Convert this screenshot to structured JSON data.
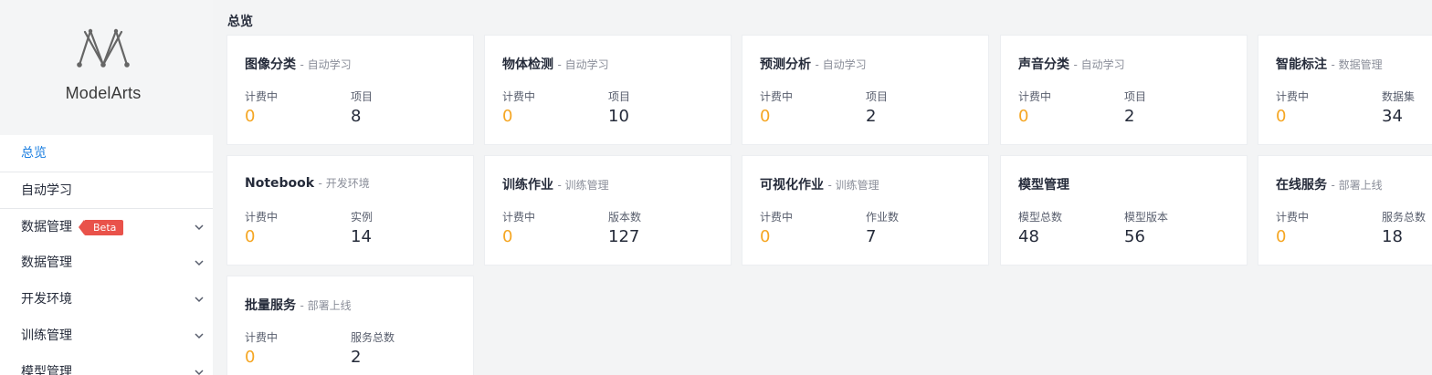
{
  "app": {
    "name": "ModelArts"
  },
  "page": {
    "title": "总览"
  },
  "sidebar": {
    "items": [
      {
        "label": "总览",
        "active": true,
        "expandable": false
      },
      {
        "label": "自动学习",
        "active": false,
        "expandable": false
      },
      {
        "label": "数据管理",
        "active": false,
        "expandable": true,
        "badge": "Beta"
      },
      {
        "label": "数据管理",
        "active": false,
        "expandable": true
      },
      {
        "label": "开发环境",
        "active": false,
        "expandable": true
      },
      {
        "label": "训练管理",
        "active": false,
        "expandable": true
      },
      {
        "label": "模型管理",
        "active": false,
        "expandable": true
      }
    ]
  },
  "cards": [
    {
      "title": "图像分类",
      "subtitle": "- 自动学习",
      "stats": [
        {
          "label": "计费中",
          "value": "0"
        },
        {
          "label": "项目",
          "value": "8"
        }
      ]
    },
    {
      "title": "物体检测",
      "subtitle": "- 自动学习",
      "stats": [
        {
          "label": "计费中",
          "value": "0"
        },
        {
          "label": "项目",
          "value": "10"
        }
      ]
    },
    {
      "title": "预测分析",
      "subtitle": "- 自动学习",
      "stats": [
        {
          "label": "计费中",
          "value": "0"
        },
        {
          "label": "项目",
          "value": "2"
        }
      ]
    },
    {
      "title": "声音分类",
      "subtitle": "- 自动学习",
      "stats": [
        {
          "label": "计费中",
          "value": "0"
        },
        {
          "label": "项目",
          "value": "2"
        }
      ]
    },
    {
      "title": "智能标注",
      "subtitle": "- 数据管理",
      "stats": [
        {
          "label": "计费中",
          "value": "0"
        },
        {
          "label": "数据集",
          "value": "34"
        }
      ]
    },
    {
      "title": "Notebook",
      "subtitle": "- 开发环境",
      "stats": [
        {
          "label": "计费中",
          "value": "0"
        },
        {
          "label": "实例",
          "value": "14"
        }
      ]
    },
    {
      "title": "训练作业",
      "subtitle": "- 训练管理",
      "stats": [
        {
          "label": "计费中",
          "value": "0"
        },
        {
          "label": "版本数",
          "value": "127"
        }
      ]
    },
    {
      "title": "可视化作业",
      "subtitle": "- 训练管理",
      "stats": [
        {
          "label": "计费中",
          "value": "0"
        },
        {
          "label": "作业数",
          "value": "7"
        }
      ]
    },
    {
      "title": "模型管理",
      "subtitle": "",
      "stats": [
        {
          "label": "模型总数",
          "value": "48"
        },
        {
          "label": "模型版本",
          "value": "56"
        }
      ]
    },
    {
      "title": "在线服务",
      "subtitle": "- 部署上线",
      "stats": [
        {
          "label": "计费中",
          "value": "0"
        },
        {
          "label": "服务总数",
          "value": "18"
        }
      ]
    },
    {
      "title": "批量服务",
      "subtitle": "- 部署上线",
      "stats": [
        {
          "label": "计费中",
          "value": "0"
        },
        {
          "label": "服务总数",
          "value": "2"
        }
      ]
    }
  ],
  "colors": {
    "accent": "#1a7ee0",
    "billing": "#f5a623",
    "beta": "#e9524a"
  }
}
